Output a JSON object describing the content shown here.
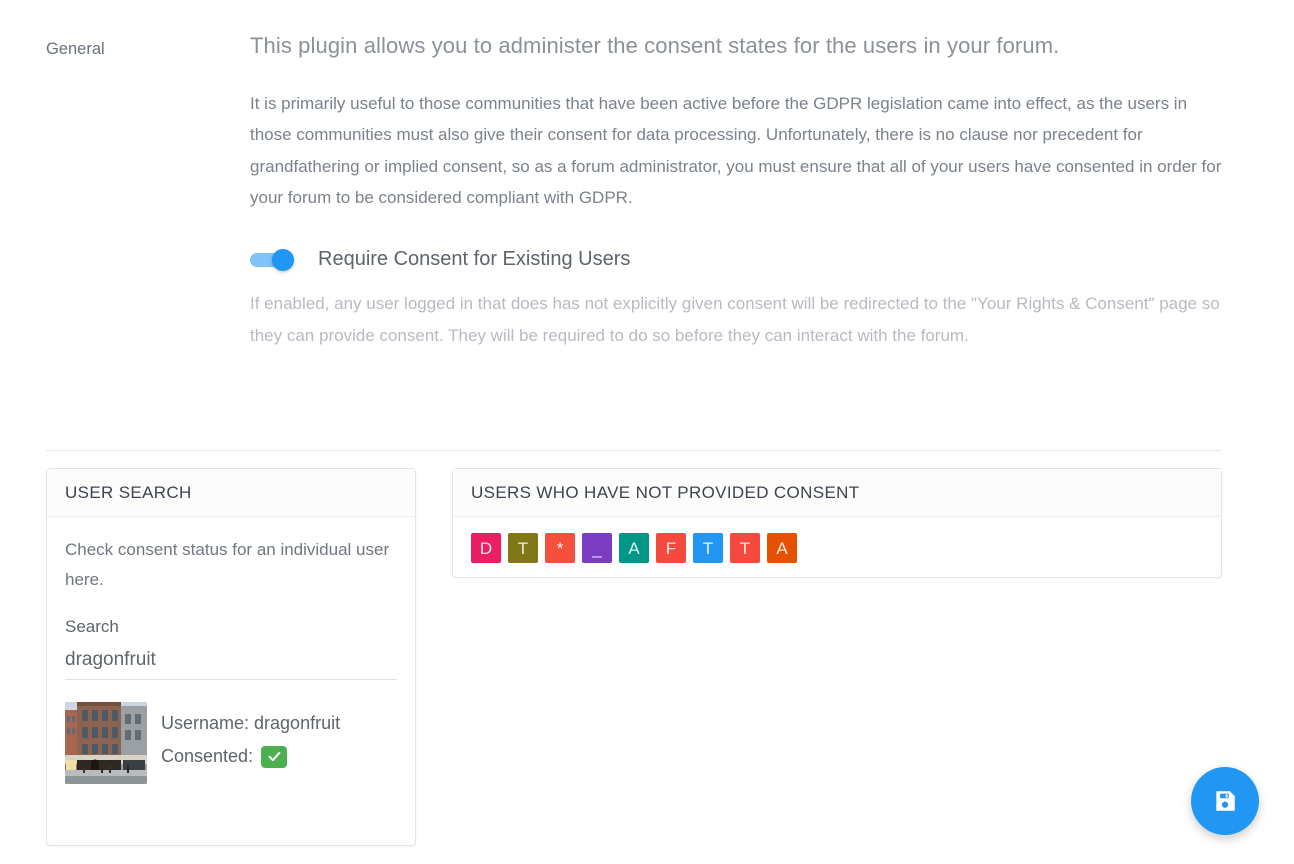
{
  "settings": {
    "legend": "General",
    "lead": "This plugin allows you to administer the consent states for the users in your forum.",
    "paragraph": "It is primarily useful to those communities that have been active before the GDPR legislation came into effect, as the users in those communities must also give their consent for data processing. Unfortunately, there is no clause nor precedent for grandfathering or implied consent, so as a forum administrator, you must ensure that all of your users have consented in order for your forum to be considered compliant with GDPR.",
    "toggle": {
      "label": "Require Consent for Existing Users",
      "state": "on",
      "track_color": "#7fc3f7",
      "knob_color": "#2196f3"
    },
    "help": "If enabled, any user logged in that does has not explicitly given consent will be redirected to the \"Your Rights & Consent\" page so they can provide consent. They will be required to do so before they can interact with the forum."
  },
  "user_search_panel": {
    "title": "USER SEARCH",
    "description": "Check consent status for an individual user here.",
    "search_label": "Search",
    "search_value": "dragonfruit",
    "search_placeholder": "",
    "result": {
      "username_line": "Username: dragonfruit",
      "consented_label": "Consented:",
      "consented": true,
      "consented_badge_color": "#4caf50",
      "avatar_alt": "building-photo"
    }
  },
  "no_consent_panel": {
    "title": "USERS WHO HAVE NOT PROVIDED CONSENT",
    "users": [
      {
        "initial": "D",
        "color": "#e91e63"
      },
      {
        "initial": "T",
        "color": "#827717"
      },
      {
        "initial": "*",
        "color": "#f4503c"
      },
      {
        "initial": "_",
        "color": "#7b3cc4"
      },
      {
        "initial": "A",
        "color": "#009688"
      },
      {
        "initial": "F",
        "color": "#f4493c"
      },
      {
        "initial": "T",
        "color": "#2196f3"
      },
      {
        "initial": "T",
        "color": "#f4493c"
      },
      {
        "initial": "A",
        "color": "#e65100"
      }
    ]
  },
  "save_button": {
    "label": "Save",
    "icon": "save-floppy-icon",
    "color": "#2196f3"
  }
}
